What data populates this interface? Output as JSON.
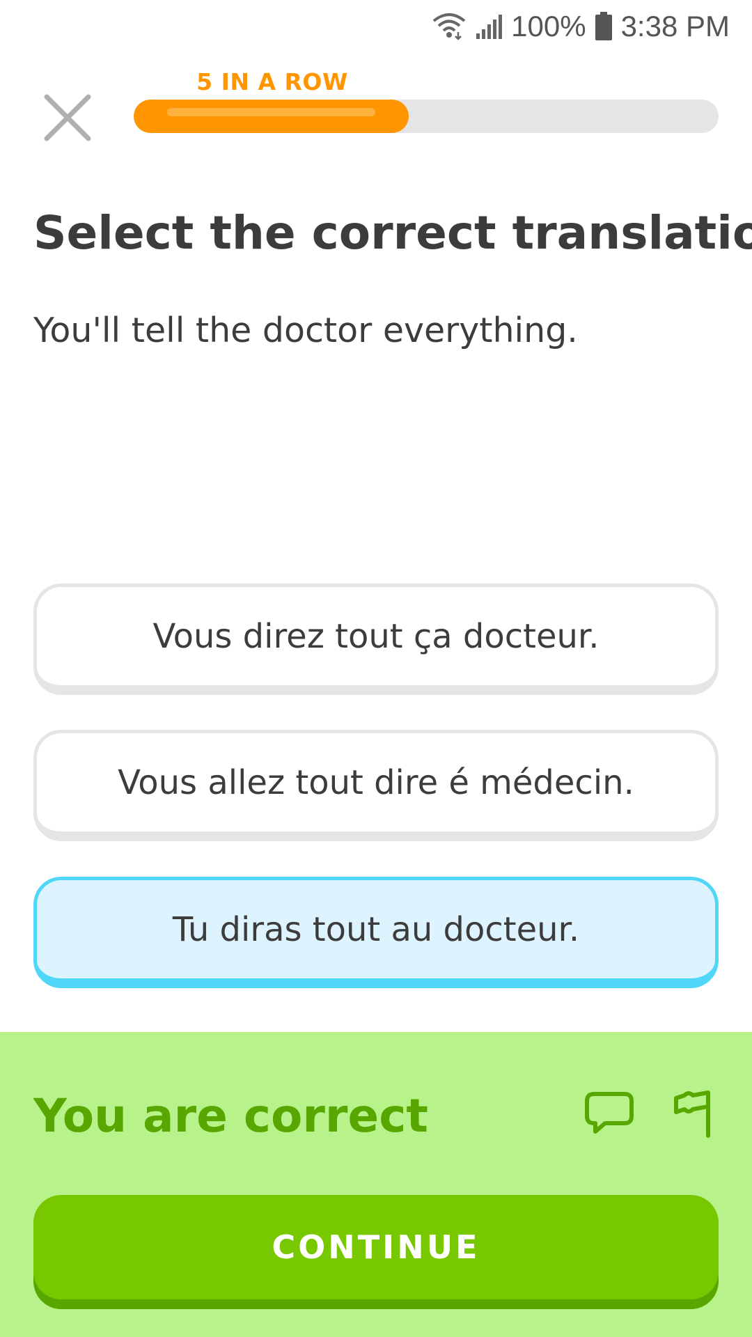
{
  "status_bar": {
    "battery_text": "100%",
    "time": "3:38 PM",
    "icons": [
      "wifi-icon",
      "signal-icon",
      "battery-icon"
    ]
  },
  "header": {
    "close_icon": "close-icon",
    "streak_label": "5 IN A ROW",
    "progress": 0.47
  },
  "prompt": {
    "title": "Select the correct translation",
    "sentence": "You'll tell the doctor everything."
  },
  "options": [
    {
      "label": "Vous direz tout ça docteur.",
      "selected": false
    },
    {
      "label": "Vous allez tout dire é médecin.",
      "selected": false
    },
    {
      "label": "Tu diras tout au docteur.",
      "selected": true
    }
  ],
  "feedback": {
    "title": "You are correct",
    "discuss_icon": "comment-icon",
    "report_icon": "flag-icon",
    "continue_label": "CONTINUE"
  },
  "colors": {
    "accent_orange": "#ff9600",
    "selected_blue": "#4fd6f8",
    "success_green": "#58a700",
    "success_bg": "#b8f28b",
    "button_green": "#78c800"
  }
}
